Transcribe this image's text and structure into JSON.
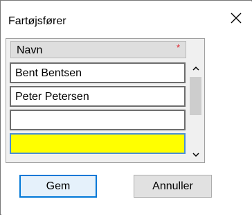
{
  "dialog": {
    "title": "Fartøjsfører",
    "close_icon": "close-icon"
  },
  "grid": {
    "column_header": "Navn",
    "required_marker": "*",
    "rows": [
      "Bent Bentsen",
      "Peter Petersen",
      "",
      ""
    ],
    "selected_row_color": "#ffff00"
  },
  "buttons": {
    "save_label": "Gem",
    "cancel_label": "Annuller"
  }
}
